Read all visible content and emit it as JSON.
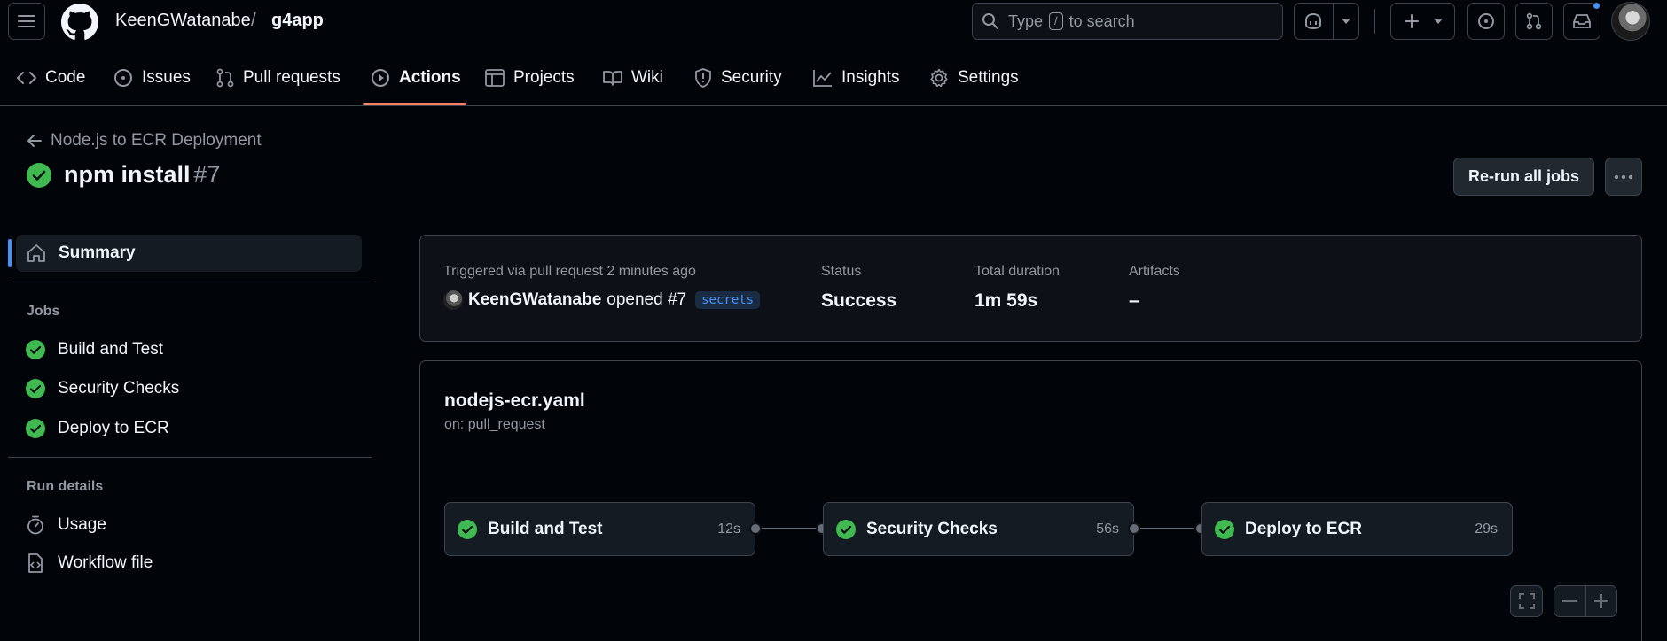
{
  "header": {
    "owner": "KeenGWatanabe",
    "separator": "/",
    "repo": "g4app",
    "search": {
      "prefix": "Type",
      "key": "/",
      "suffix": "to search"
    }
  },
  "tabs": [
    {
      "label": "Code",
      "icon": "code-icon"
    },
    {
      "label": "Issues",
      "icon": "issue-opened-icon"
    },
    {
      "label": "Pull requests",
      "icon": "git-pull-request-icon"
    },
    {
      "label": "Actions",
      "icon": "play-icon",
      "active": true
    },
    {
      "label": "Projects",
      "icon": "table-icon"
    },
    {
      "label": "Wiki",
      "icon": "book-icon"
    },
    {
      "label": "Security",
      "icon": "shield-icon"
    },
    {
      "label": "Insights",
      "icon": "graph-icon"
    },
    {
      "label": "Settings",
      "icon": "gear-icon"
    }
  ],
  "run": {
    "back_label": "Node.js to ECR Deployment",
    "title": "npm install",
    "number": "#7",
    "rerun_label": "Re-run all jobs"
  },
  "sidebar": {
    "summary": "Summary",
    "jobs_heading": "Jobs",
    "jobs": [
      "Build and Test",
      "Security Checks",
      "Deploy to ECR"
    ],
    "run_details_heading": "Run details",
    "usage": "Usage",
    "workflow_file": "Workflow file"
  },
  "summary": {
    "triggered": "Triggered via pull request 2 minutes ago",
    "actor": "KeenGWatanabe",
    "action": "opened #7",
    "branch": "secrets",
    "status_label": "Status",
    "status": "Success",
    "duration_label": "Total duration",
    "duration": "1m 59s",
    "artifacts_label": "Artifacts",
    "artifacts": "–"
  },
  "workflow": {
    "file": "nodejs-ecr.yaml",
    "on": "on: pull_request",
    "jobs": [
      {
        "name": "Build and Test",
        "duration": "12s"
      },
      {
        "name": "Security Checks",
        "duration": "56s"
      },
      {
        "name": "Deploy to ECR",
        "duration": "29s"
      }
    ]
  },
  "colors": {
    "success": "#3fb950",
    "accent": "#4493f8",
    "tab_underline": "#f78166",
    "background": "#010409"
  }
}
